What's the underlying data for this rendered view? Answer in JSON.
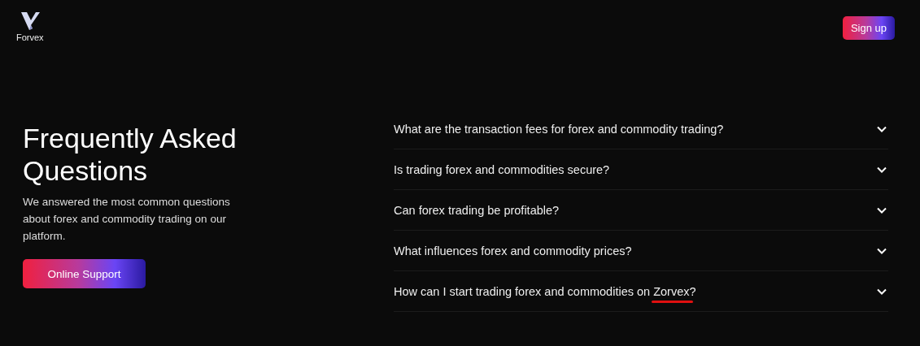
{
  "header": {
    "brand": "Forvex",
    "signup_button": "Sign up"
  },
  "intro": {
    "title": "Frequently Asked Questions",
    "description": "We answered the most common questions about forex and commodity trading on our platform.",
    "support_button": "Online Support"
  },
  "faq": [
    {
      "question": "What are the transaction fees for forex and commodity trading?",
      "expanded": false,
      "last_word_marked": false
    },
    {
      "question": "Is trading forex and commodities secure?",
      "expanded": false,
      "last_word_marked": false
    },
    {
      "question": "Can forex trading be profitable?",
      "expanded": false,
      "last_word_marked": false
    },
    {
      "question": "What influences forex and commodity prices?",
      "expanded": false,
      "last_word_marked": false
    },
    {
      "question": "How can I start trading forex and commodities on Zorvex?",
      "expanded": false,
      "last_word_marked": true
    }
  ]
}
